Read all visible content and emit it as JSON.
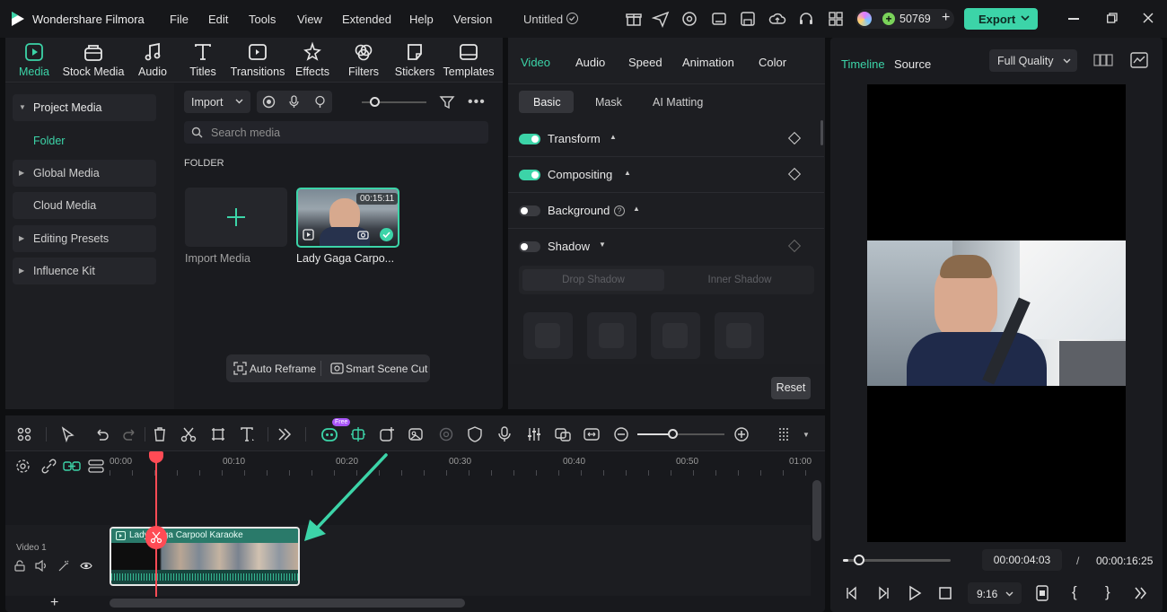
{
  "app": {
    "name": "Wondershare Filmora",
    "project_title": "Untitled",
    "credits": "50769",
    "export_label": "Export"
  },
  "menu": [
    "File",
    "Edit",
    "Tools",
    "View",
    "Extended",
    "Help",
    "Version"
  ],
  "tool_tabs": [
    "Media",
    "Stock Media",
    "Audio",
    "Titles",
    "Transitions",
    "Effects",
    "Filters",
    "Stickers",
    "Templates"
  ],
  "sidebar": {
    "items": [
      "Project Media",
      "Folder",
      "Global Media",
      "Cloud Media",
      "Editing Presets",
      "Influence Kit"
    ]
  },
  "media": {
    "import_label": "Import",
    "search_placeholder": "Search media",
    "section": "FOLDER",
    "import_tile": "Import Media",
    "clip_name": "Lady Gaga Carpo...",
    "clip_duration": "00:15:11",
    "auto_reframe": "Auto Reframe",
    "smart_scene_cut": "Smart Scene Cut"
  },
  "props": {
    "tabs": [
      "Video",
      "Audio",
      "Speed",
      "Animation",
      "Color"
    ],
    "subtabs": [
      "Basic",
      "Mask",
      "AI Matting"
    ],
    "rows": [
      "Transform",
      "Compositing",
      "Background",
      "Shadow"
    ],
    "shadow_tabs": [
      "Drop Shadow",
      "Inner Shadow"
    ],
    "reset": "Reset"
  },
  "player": {
    "tabs": [
      "Timeline",
      "Source"
    ],
    "quality": "Full Quality",
    "current_time": "00:00:04:03",
    "separator": "/",
    "total_time": "00:00:16:25",
    "aspect": "9:16",
    "progress": 0.05
  },
  "timeline": {
    "ruler": [
      "00:00",
      "00:10",
      "00:20",
      "00:30",
      "00:40",
      "00:50",
      "01:00"
    ],
    "track_label": "Video 1",
    "clip_title": "Lady Gaga Carpool Karaoke",
    "free_badge": "Free"
  },
  "colors": {
    "accent": "#3cd4a8",
    "playhead": "#ff4b55",
    "export_bg": "#3cd4a8"
  }
}
